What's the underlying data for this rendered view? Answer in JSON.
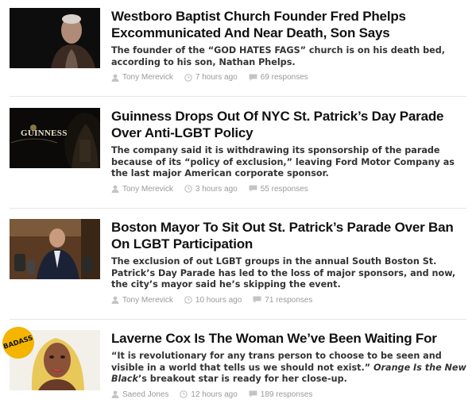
{
  "articles": [
    {
      "headline": "Westboro Baptist Church Founder Fred Phelps Excommunicated And Near Death, Son Says",
      "desc": "The founder of the “GOD HATES FAGS” church is on his death bed, according to his son, Nathan Phelps.",
      "author": "Tony Merevick",
      "time": "7 hours ago",
      "responses": "69 responses"
    },
    {
      "headline": "Guinness Drops Out Of NYC St. Patrick’s Day Parade Over Anti-LGBT Policy",
      "desc": "The company said it is withdrawing its sponsorship of the parade because of its “policy of exclusion,” leaving Ford Motor Company as the last major American corporate sponsor.",
      "author": "Tony Merevick",
      "time": "3 hours ago",
      "responses": "55 responses",
      "thumb_text": "GUINNESS"
    },
    {
      "headline": "Boston Mayor To Sit Out St. Patrick’s Parade Over Ban On LGBT Participation",
      "desc": "The exclusion of out LGBT groups in the annual South Boston St. Patrick’s Day Parade has led to the loss of major sponsors, and now, the city’s mayor said he’s skipping the event.",
      "author": "Tony Merevick",
      "time": "10 hours ago",
      "responses": "71 responses"
    },
    {
      "headline": "Laverne Cox Is The Woman We’ve Been Waiting For",
      "desc_part1": "“It is revolutionary for any trans person to choose to be seen and visible in a world that tells us we should not exist.” ",
      "desc_italic": "Orange Is the New Black",
      "desc_part2": "’s breakout star is ready for her close-up.",
      "author": "Saeed Jones",
      "time": "12 hours ago",
      "responses": "189 responses",
      "badge": "BADASS"
    }
  ],
  "icons": {
    "author": "person-icon",
    "time": "clock-icon",
    "responses": "speech-bubble-icon"
  },
  "colors": {
    "meta_gray": "#9a9a9a",
    "badge_yellow": "#f4b400"
  }
}
